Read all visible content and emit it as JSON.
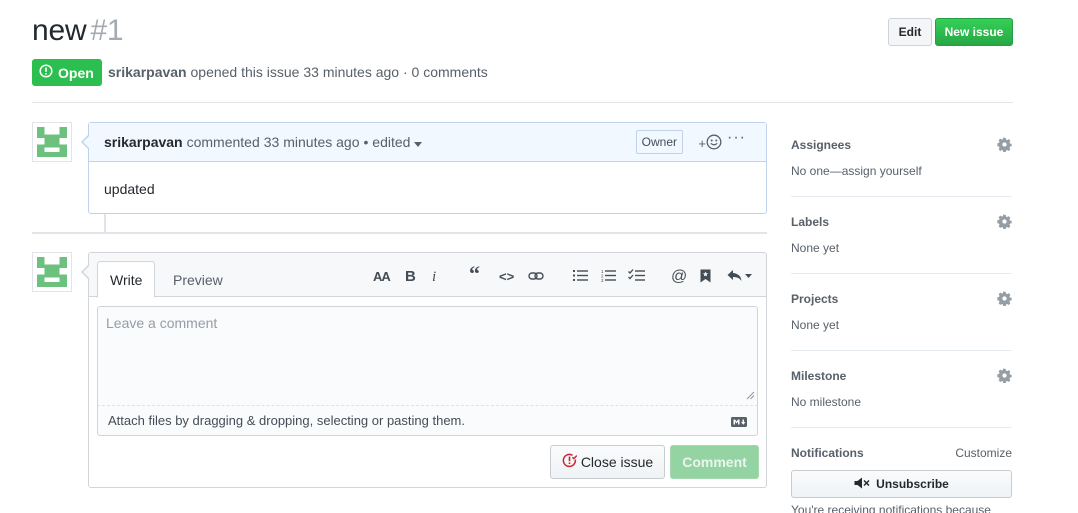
{
  "issue": {
    "title": "new",
    "number": "#1",
    "state": "Open",
    "author": "srikarpavan",
    "meta_text": "opened this issue 33 minutes ago · 0 comments"
  },
  "header": {
    "edit_label": "Edit",
    "new_issue_label": "New issue"
  },
  "comment": {
    "author": "srikarpavan",
    "action": "commented",
    "time": "33 minutes ago",
    "edited": "• edited",
    "role_badge": "Owner",
    "reaction_label": "+",
    "more_label": "···",
    "body": "updated"
  },
  "editor": {
    "tab_write": "Write",
    "tab_preview": "Preview",
    "placeholder": "Leave a comment",
    "attach_hint": "Attach files by dragging & dropping, selecting or pasting them.",
    "close_issue_label": "Close issue",
    "comment_label": "Comment",
    "toolbar": {
      "heading": "AA",
      "bold": "B",
      "italic": "i",
      "quote": "“",
      "code": "<>",
      "mention": "@"
    }
  },
  "sidebar": {
    "assignees": {
      "heading": "Assignees",
      "value": "No one—assign yourself"
    },
    "labels": {
      "heading": "Labels",
      "value": "None yet"
    },
    "projects": {
      "heading": "Projects",
      "value": "None yet"
    },
    "milestone": {
      "heading": "Milestone",
      "value": "No milestone"
    },
    "notifications": {
      "heading": "Notifications",
      "customize": "Customize",
      "unsubscribe_label": "Unsubscribe",
      "notice": "You're receiving notifications because"
    }
  },
  "colors": {
    "open_green": "#2cbe4e",
    "new_issue_green": "#28a745",
    "comment_header_blue": "#f1f8ff",
    "avatar_green": "#6cc17f"
  }
}
